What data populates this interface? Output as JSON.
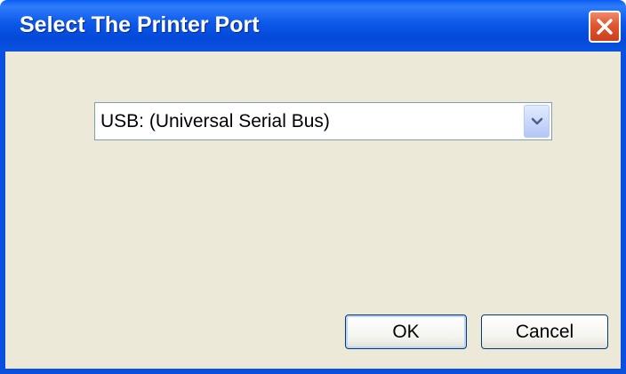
{
  "window": {
    "title": "Select The Printer Port",
    "title_bar_color": "#0a5df2",
    "close_icon": "close-icon"
  },
  "port_select": {
    "selected_value": "USB: (Universal Serial Bus)",
    "arrow_icon": "chevron-down-icon"
  },
  "buttons": {
    "ok_label": "OK",
    "cancel_label": "Cancel"
  },
  "colors": {
    "dialog_background": "#ece9d8",
    "close_button": "#e1552f"
  }
}
